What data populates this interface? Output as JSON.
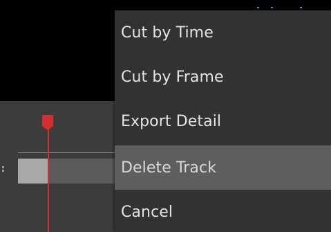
{
  "context_menu": {
    "items": [
      {
        "label": "Cut by Time",
        "highlighted": false
      },
      {
        "label": "Cut by Frame",
        "highlighted": false
      },
      {
        "label": "Export Detail",
        "highlighted": false
      },
      {
        "label": "Delete Track",
        "highlighted": true
      },
      {
        "label": "Cancel",
        "highlighted": false
      }
    ]
  },
  "colors": {
    "playhead": "#d2302c",
    "menu_background": "#323232",
    "menu_highlight": "#5e5e5e",
    "menu_text": "#e4e4e4",
    "preview_background": "#000000",
    "timeline_background": "#3c3c3c"
  },
  "icons": {
    "playhead": "playhead-marker-icon"
  }
}
